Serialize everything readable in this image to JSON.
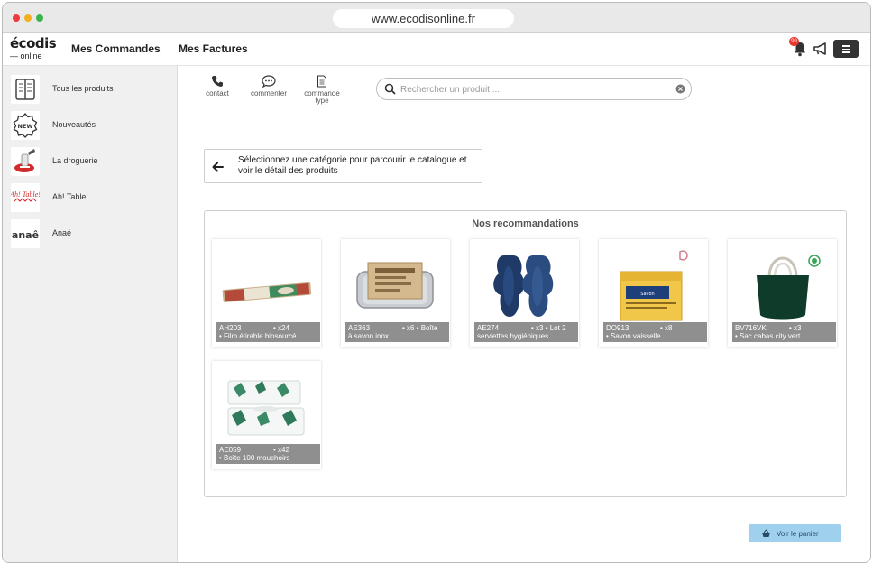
{
  "browser": {
    "url": "www.ecodisonline.fr"
  },
  "header": {
    "logo_line1": "écodis",
    "logo_line2": "— online",
    "nav": [
      "Mes Commandes",
      "Mes Factures"
    ],
    "notification_count": "99"
  },
  "sidebar": {
    "items": [
      {
        "label": "Tous les produits",
        "icon": "catalog-icon"
      },
      {
        "label": "Nouveautés",
        "icon": "new-badge-icon"
      },
      {
        "label": "La droguerie",
        "icon": "droguerie-icon"
      },
      {
        "label": "Ah! Table!",
        "icon": "ah-table-logo"
      },
      {
        "label": "Anaé",
        "icon": "anae-logo",
        "logo_text": "anaê"
      }
    ]
  },
  "toolbar": {
    "contact_label": "contact",
    "comment_label": "commenter",
    "order_template_label": "commande type",
    "search_placeholder": "Rechercher un produit ..."
  },
  "hint": {
    "text": "Sélectionnez une catégorie pour parcourir le catalogue et voir le détail des produits"
  },
  "recommendations": {
    "title": "Nos recommandations",
    "products": [
      {
        "ref": "AH203",
        "qty": "• x24",
        "name": "• Film étirable biosourcé"
      },
      {
        "ref": "AE363",
        "qty": "• x6 • Boîte",
        "name": "à savon inox"
      },
      {
        "ref": "AE274",
        "qty": "• x3 • Lot 2",
        "name": "serviettes hygiéniques"
      },
      {
        "ref": "DO913",
        "qty": "• x8",
        "name": "• Savon vaisselle"
      },
      {
        "ref": "BV716VK",
        "qty": "• x3",
        "name": "• Sac cabas city vert"
      },
      {
        "ref": "AE059",
        "qty": "• x42",
        "name": "• Boîte 100 mouchoirs"
      }
    ]
  },
  "cart": {
    "label": "Voir le panier"
  },
  "colors": {
    "accent": "#9fd1ef",
    "badge": "#e8352e",
    "caption_bg": "#8f8f8f"
  }
}
